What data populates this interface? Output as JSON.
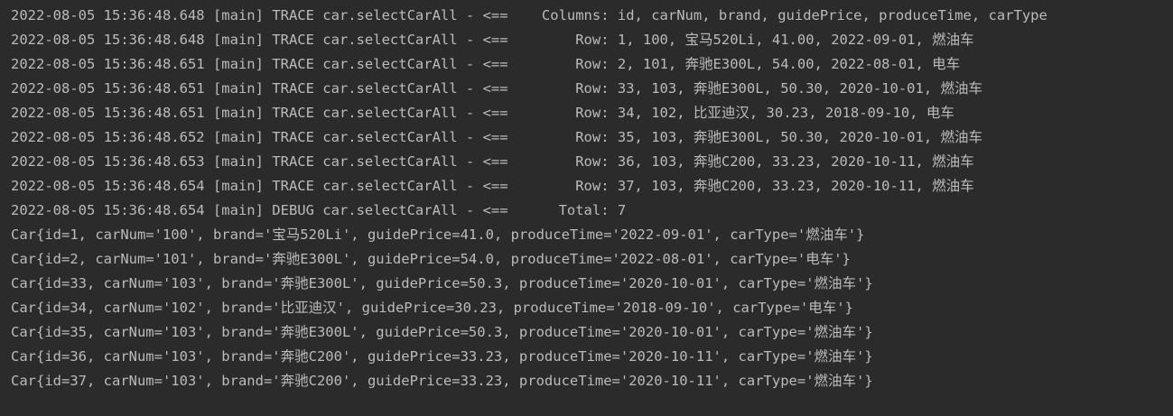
{
  "console": {
    "lines": [
      "2022-08-05 15:36:48.648 [main] TRACE car.selectCarAll - <==    Columns: id, carNum, brand, guidePrice, produceTime, carType",
      "2022-08-05 15:36:48.648 [main] TRACE car.selectCarAll - <==        Row: 1, 100, 宝马520Li, 41.00, 2022-09-01, 燃油车",
      "2022-08-05 15:36:48.651 [main] TRACE car.selectCarAll - <==        Row: 2, 101, 奔驰E300L, 54.00, 2022-08-01, 电车",
      "2022-08-05 15:36:48.651 [main] TRACE car.selectCarAll - <==        Row: 33, 103, 奔驰E300L, 50.30, 2020-10-01, 燃油车",
      "2022-08-05 15:36:48.651 [main] TRACE car.selectCarAll - <==        Row: 34, 102, 比亚迪汉, 30.23, 2018-09-10, 电车",
      "2022-08-05 15:36:48.652 [main] TRACE car.selectCarAll - <==        Row: 35, 103, 奔驰E300L, 50.30, 2020-10-01, 燃油车",
      "2022-08-05 15:36:48.653 [main] TRACE car.selectCarAll - <==        Row: 36, 103, 奔驰C200, 33.23, 2020-10-11, 燃油车",
      "2022-08-05 15:36:48.654 [main] TRACE car.selectCarAll - <==        Row: 37, 103, 奔驰C200, 33.23, 2020-10-11, 燃油车",
      "2022-08-05 15:36:48.654 [main] DEBUG car.selectCarAll - <==      Total: 7",
      "Car{id=1, carNum='100', brand='宝马520Li', guidePrice=41.0, produceTime='2022-09-01', carType='燃油车'}",
      "Car{id=2, carNum='101', brand='奔驰E300L', guidePrice=54.0, produceTime='2022-08-01', carType='电车'}",
      "Car{id=33, carNum='103', brand='奔驰E300L', guidePrice=50.3, produceTime='2020-10-01', carType='燃油车'}",
      "Car{id=34, carNum='102', brand='比亚迪汉', guidePrice=30.23, produceTime='2018-09-10', carType='电车'}",
      "Car{id=35, carNum='103', brand='奔驰E300L', guidePrice=50.3, produceTime='2020-10-01', carType='燃油车'}",
      "Car{id=36, carNum='103', brand='奔驰C200', guidePrice=33.23, produceTime='2020-10-11', carType='燃油车'}",
      "Car{id=37, carNum='103', brand='奔驰C200', guidePrice=33.23, produceTime='2020-10-11', carType='燃油车'}"
    ]
  },
  "colors": {
    "background": "#2b2b2b",
    "text": "#bbbbbb"
  }
}
